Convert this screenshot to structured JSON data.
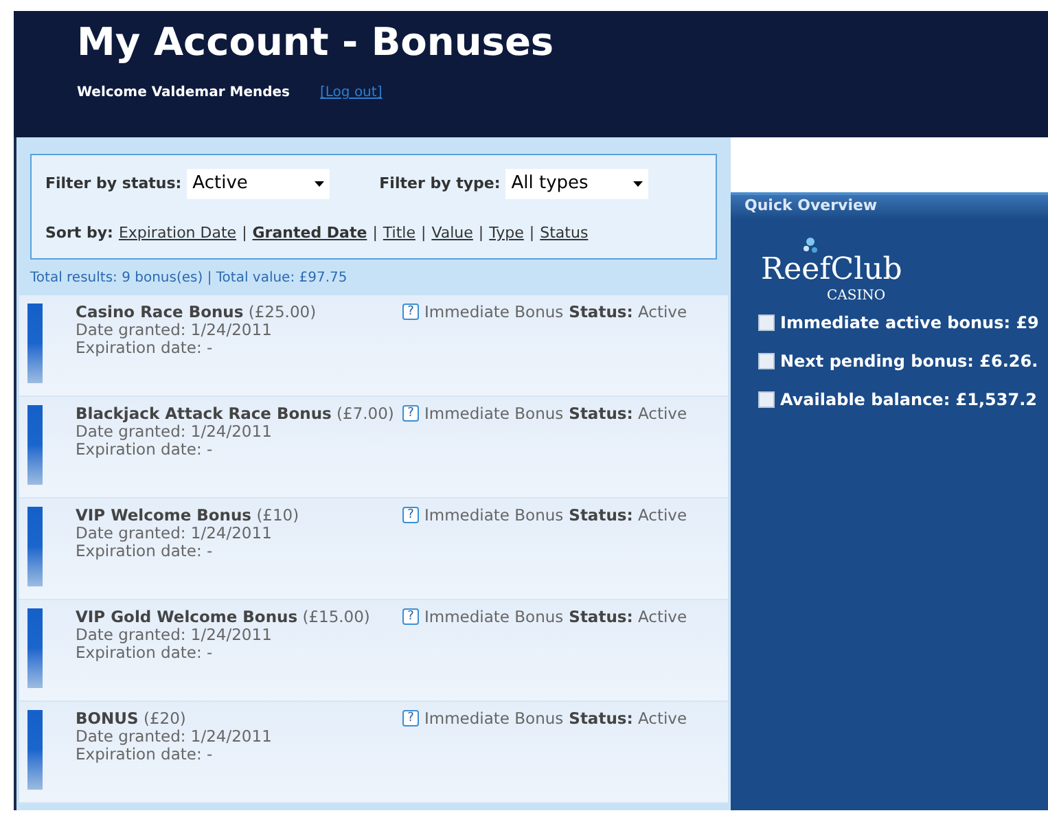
{
  "header": {
    "title": "My Account - Bonuses",
    "welcome": "Welcome Valdemar Mendes",
    "logout": "[Log out]"
  },
  "filters": [
    {
      "label": "Filter by status:",
      "value": "Active"
    },
    {
      "label": "Filter by type:",
      "value": "All types"
    }
  ],
  "sort": {
    "label": "Sort by:",
    "separator": "|",
    "options": [
      {
        "label": "Expiration Date",
        "selected": false
      },
      {
        "label": "Granted Date",
        "selected": true
      },
      {
        "label": "Title",
        "selected": false
      },
      {
        "label": "Value",
        "selected": false
      },
      {
        "label": "Type",
        "selected": false
      },
      {
        "label": "Status",
        "selected": false
      }
    ]
  },
  "help_mark": "?",
  "totals": "Total results: 9 bonus(es) | Total value: £97.75",
  "bonuses": [
    {
      "title": "Casino Race Bonus",
      "amount": "(£25.00)",
      "granted": "Date granted: 1/24/2011",
      "expiration": "Expiration date: -",
      "type": "Immediate Bonus",
      "status_label": "Status:",
      "status": "Active"
    },
    {
      "title": "Blackjack Attack Race Bonus",
      "amount": "(£7.00)",
      "granted": "Date granted: 1/24/2011",
      "expiration": "Expiration date: -",
      "type": "Immediate Bonus",
      "status_label": "Status:",
      "status": "Active"
    },
    {
      "title": "VIP Welcome Bonus",
      "amount": "(£10)",
      "granted": "Date granted: 1/24/2011",
      "expiration": "Expiration date: -",
      "type": "Immediate Bonus",
      "status_label": "Status:",
      "status": "Active"
    },
    {
      "title": "VIP Gold Welcome Bonus",
      "amount": "(£15.00)",
      "granted": "Date granted: 1/24/2011",
      "expiration": "Expiration date: -",
      "type": "Immediate Bonus",
      "status_label": "Status:",
      "status": "Active"
    },
    {
      "title": "BONUS",
      "amount": "(£20)",
      "granted": "Date granted: 1/24/2011",
      "expiration": "Expiration date: -",
      "type": "Immediate Bonus",
      "status_label": "Status:",
      "status": "Active"
    }
  ],
  "overview": {
    "title": "Quick Overview",
    "logo": {
      "name": "ReefClub",
      "sub": "CASINO"
    },
    "items": [
      "Immediate active bonus: £9",
      "Next pending bonus: £6.26.",
      "Available balance: £1,537.2"
    ]
  }
}
